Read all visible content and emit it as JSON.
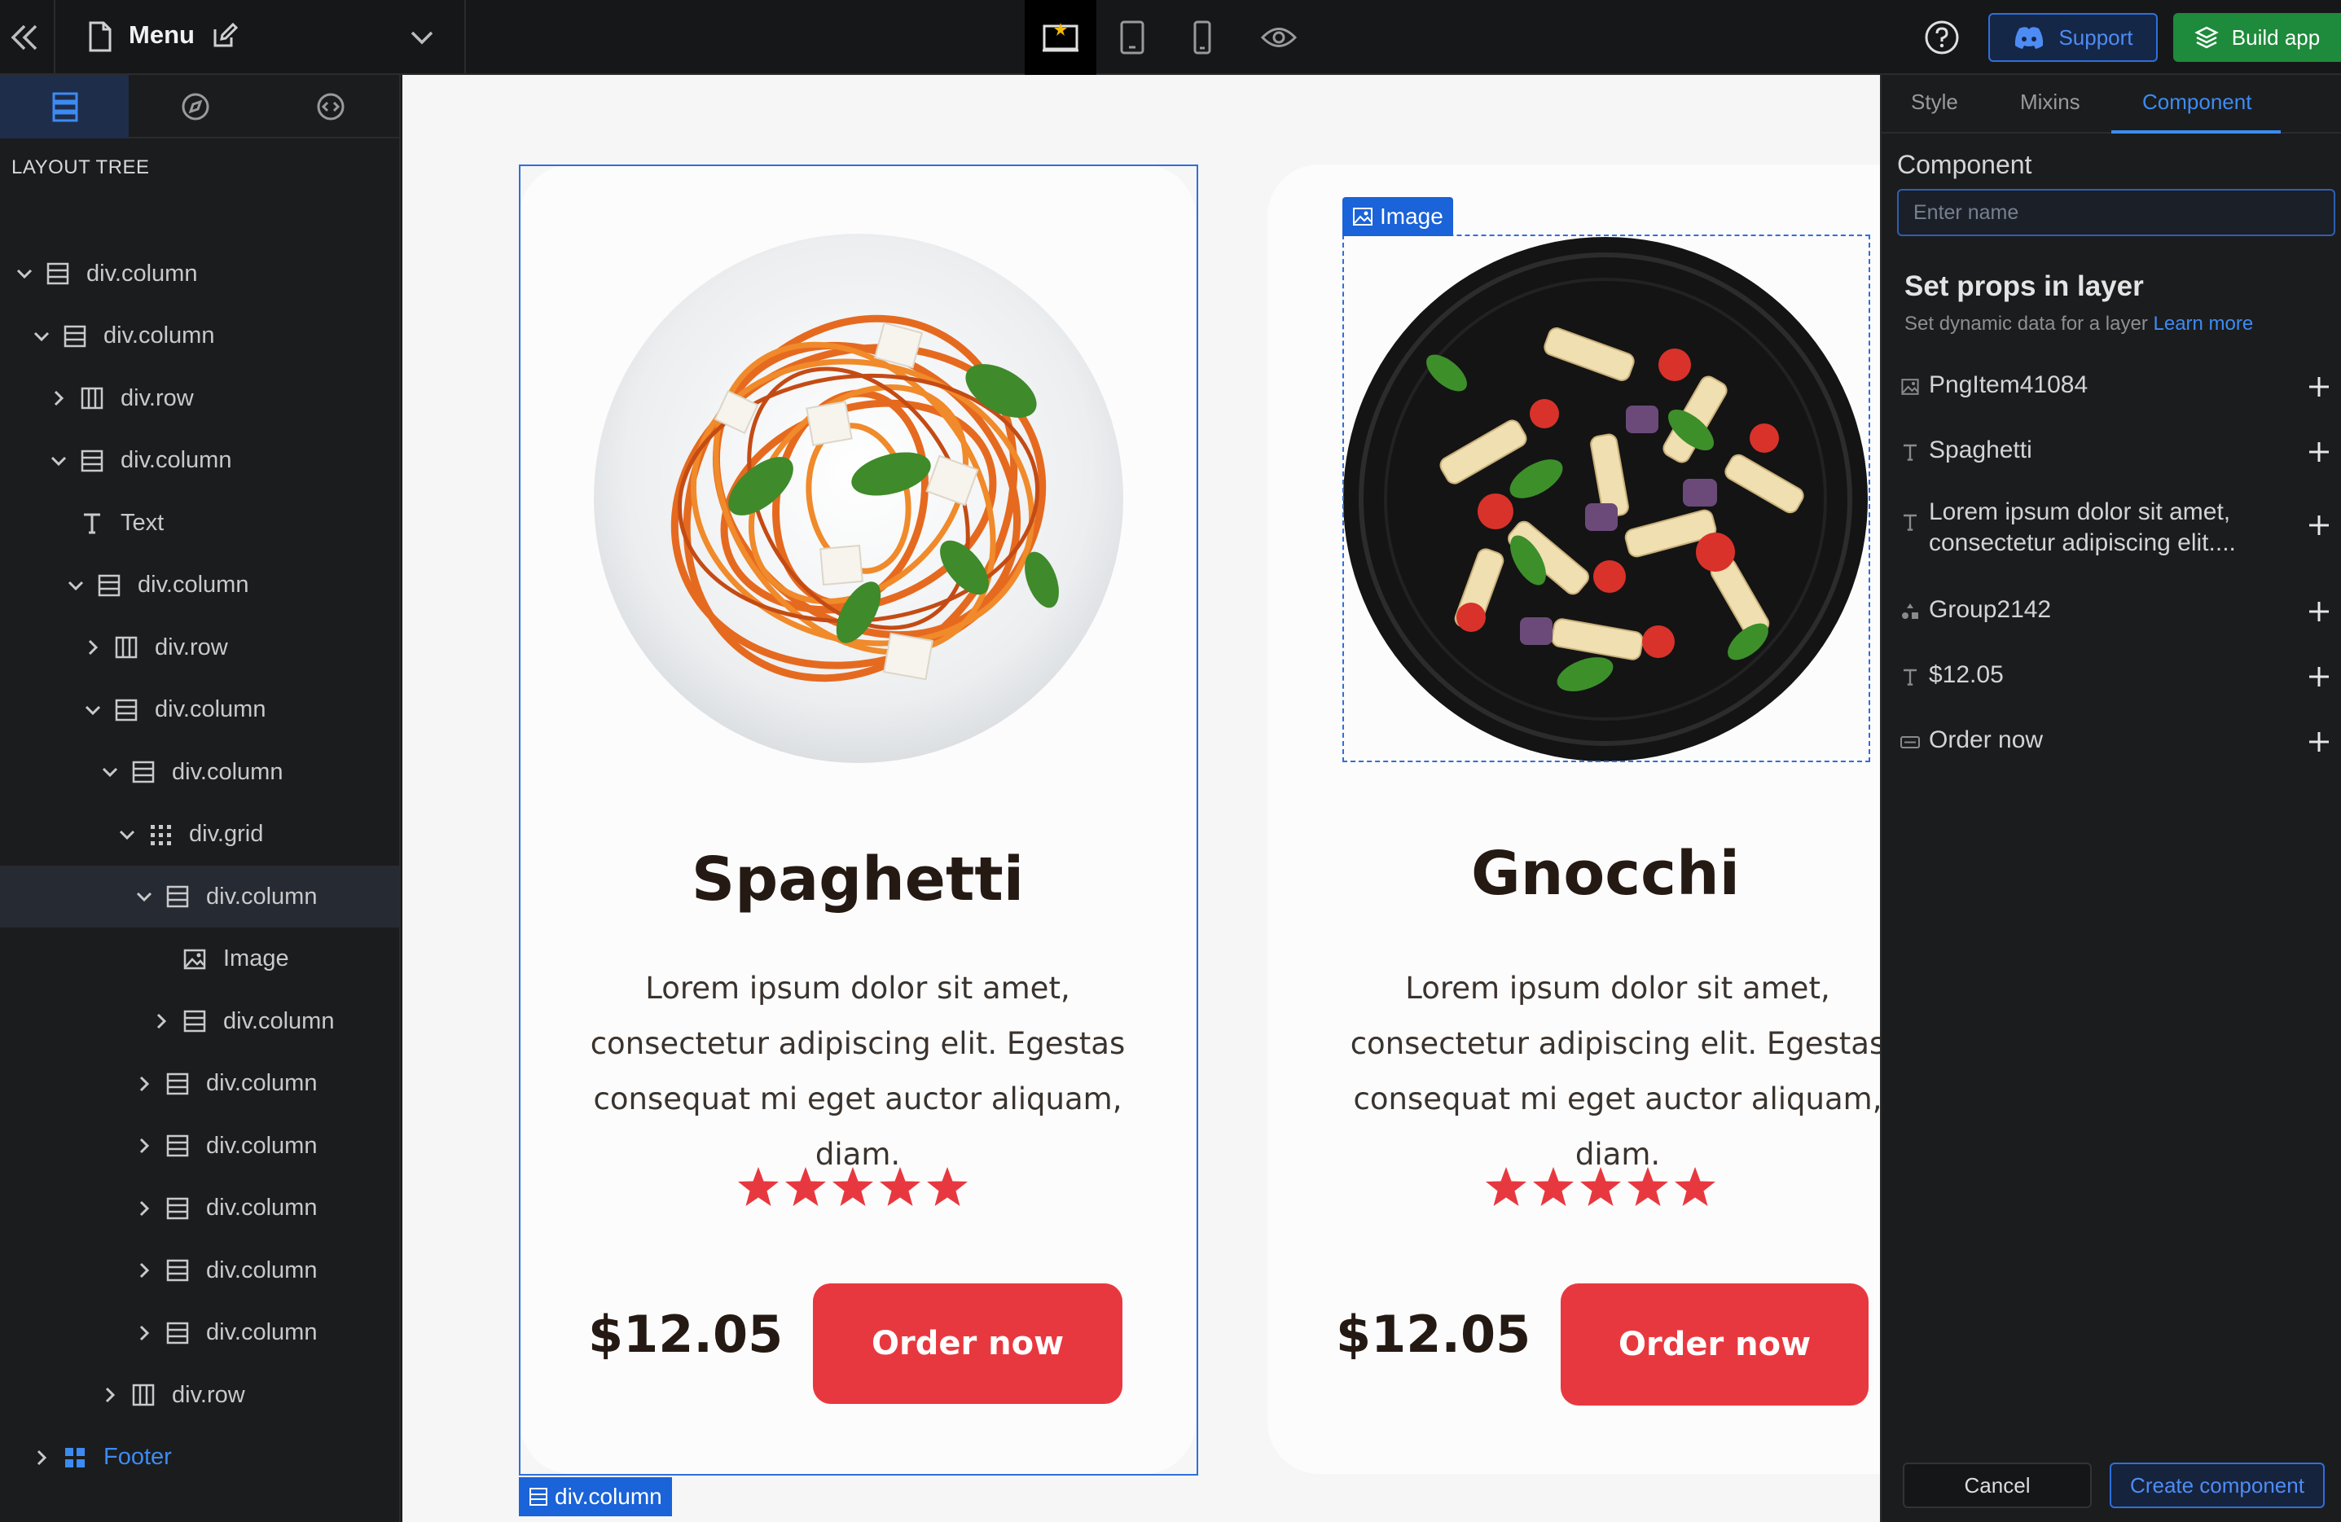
{
  "topbar": {
    "page_title": "Menu",
    "support_label": "Support",
    "build_label": "Build app"
  },
  "left_panel": {
    "tree_heading": "LAYOUT TREE",
    "tree": [
      {
        "label": "div.column",
        "icon": "column-icon",
        "expanded": true
      },
      {
        "label": "div.column",
        "icon": "column-icon",
        "expanded": true
      },
      {
        "label": "div.row",
        "icon": "row-icon",
        "expanded": false
      },
      {
        "label": "div.column",
        "icon": "column-icon",
        "expanded": true
      },
      {
        "label": "Text",
        "icon": "text-icon",
        "expanded": null
      },
      {
        "label": "div.column",
        "icon": "column-icon",
        "expanded": true
      },
      {
        "label": "div.row",
        "icon": "row-icon",
        "expanded": false
      },
      {
        "label": "div.column",
        "icon": "column-icon",
        "expanded": true
      },
      {
        "label": "div.column",
        "icon": "column-icon",
        "expanded": true
      },
      {
        "label": "div.grid",
        "icon": "grid-icon",
        "expanded": true
      },
      {
        "label": "div.column",
        "icon": "column-icon",
        "expanded": true,
        "selected": true
      },
      {
        "label": "Image",
        "icon": "image-icon",
        "expanded": null
      },
      {
        "label": "div.column",
        "icon": "column-icon",
        "expanded": false
      },
      {
        "label": "div.column",
        "icon": "column-icon",
        "expanded": false
      },
      {
        "label": "div.column",
        "icon": "column-icon",
        "expanded": false
      },
      {
        "label": "div.column",
        "icon": "column-icon",
        "expanded": false
      },
      {
        "label": "div.column",
        "icon": "column-icon",
        "expanded": false
      },
      {
        "label": "div.column",
        "icon": "column-icon",
        "expanded": false
      },
      {
        "label": "div.row",
        "icon": "row-icon",
        "expanded": false
      },
      {
        "label": "Footer",
        "icon": "component-icon",
        "expanded": false
      }
    ]
  },
  "canvas": {
    "cards": [
      {
        "name": "Spaghetti",
        "description": "Lorem ipsum dolor sit amet, consectetur adipiscing elit. Egestas consequat mi eget auctor aliquam, diam.",
        "rating": 5,
        "price": "$12.05",
        "button": "Order now"
      },
      {
        "name": "Gnocchi",
        "description": "Lorem ipsum dolor sit amet, consectetur adipiscing elit. Egestas consequat mi eget auctor aliquam, diam.",
        "rating": 5,
        "price": "$12.05",
        "button": "Order now"
      }
    ],
    "selection_tag": "div.column",
    "hover_tag": "Image"
  },
  "right_panel": {
    "tabs": [
      "Style",
      "Mixins",
      "Component"
    ],
    "active_tab": "Component",
    "component_label": "Component",
    "name_placeholder": "Enter name",
    "props_heading": "Set props in layer",
    "props_sub": "Set dynamic data for a layer",
    "learn_more": "Learn more",
    "props": [
      {
        "label": "PngItem41084",
        "icon": "image-icon"
      },
      {
        "label": "Spaghetti",
        "icon": "text-icon"
      },
      {
        "label": "Lorem ipsum dolor sit amet, consectetur adipiscing elit....",
        "icon": "text-icon"
      },
      {
        "label": "Group2142",
        "icon": "group-icon"
      },
      {
        "label": "$12.05",
        "icon": "text-icon"
      },
      {
        "label": "Order now",
        "icon": "button-icon"
      }
    ],
    "cancel_label": "Cancel",
    "create_label": "Create component"
  },
  "colors": {
    "accent": "#3d8bf2",
    "order_button": "#e8383f",
    "star": "#e8383f",
    "build_green": "#1e8a3b"
  }
}
